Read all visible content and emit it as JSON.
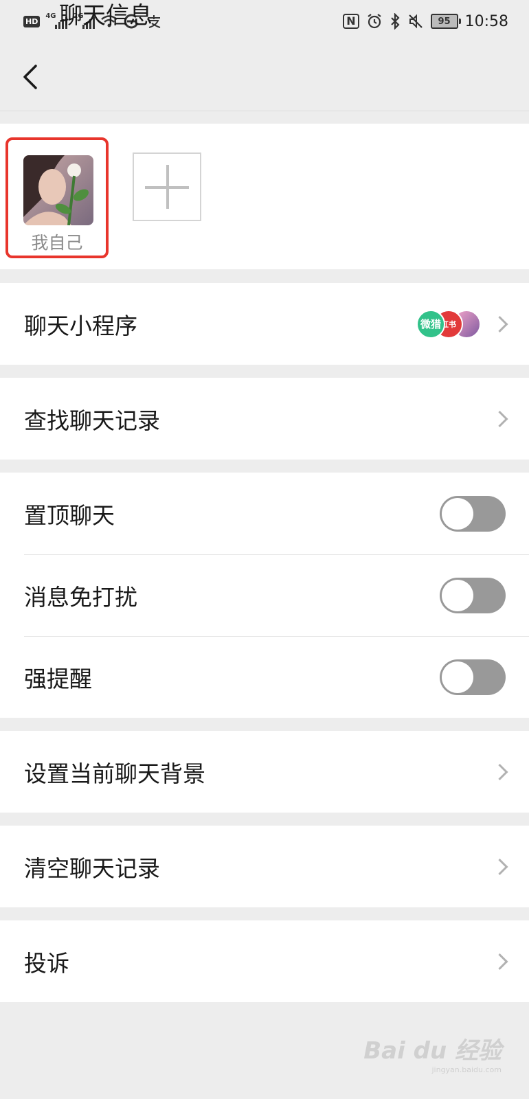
{
  "status_bar": {
    "hd": "HD",
    "signal1": "4G",
    "signal2": "2G",
    "battery": "95",
    "time": "10:58"
  },
  "nav": {
    "title": "聊天信息"
  },
  "members": [
    {
      "name": "我自己"
    }
  ],
  "mini_apps": [
    "微猎",
    "红书"
  ],
  "rows": {
    "mini_programs": "聊天小程序",
    "search_history": "查找聊天记录",
    "sticky_on_top": "置顶聊天",
    "mute": "消息免打扰",
    "strong_reminder": "强提醒",
    "set_background": "设置当前聊天背景",
    "clear_history": "清空聊天记录",
    "report": "投诉"
  },
  "toggles": {
    "sticky_on_top": false,
    "mute": false,
    "strong_reminder": false
  },
  "colors": {
    "highlight": "#e8352c",
    "toggle_off": "#999999"
  },
  "watermark": {
    "brand": "Bai du 经验",
    "url": "jingyan.baidu.com"
  }
}
